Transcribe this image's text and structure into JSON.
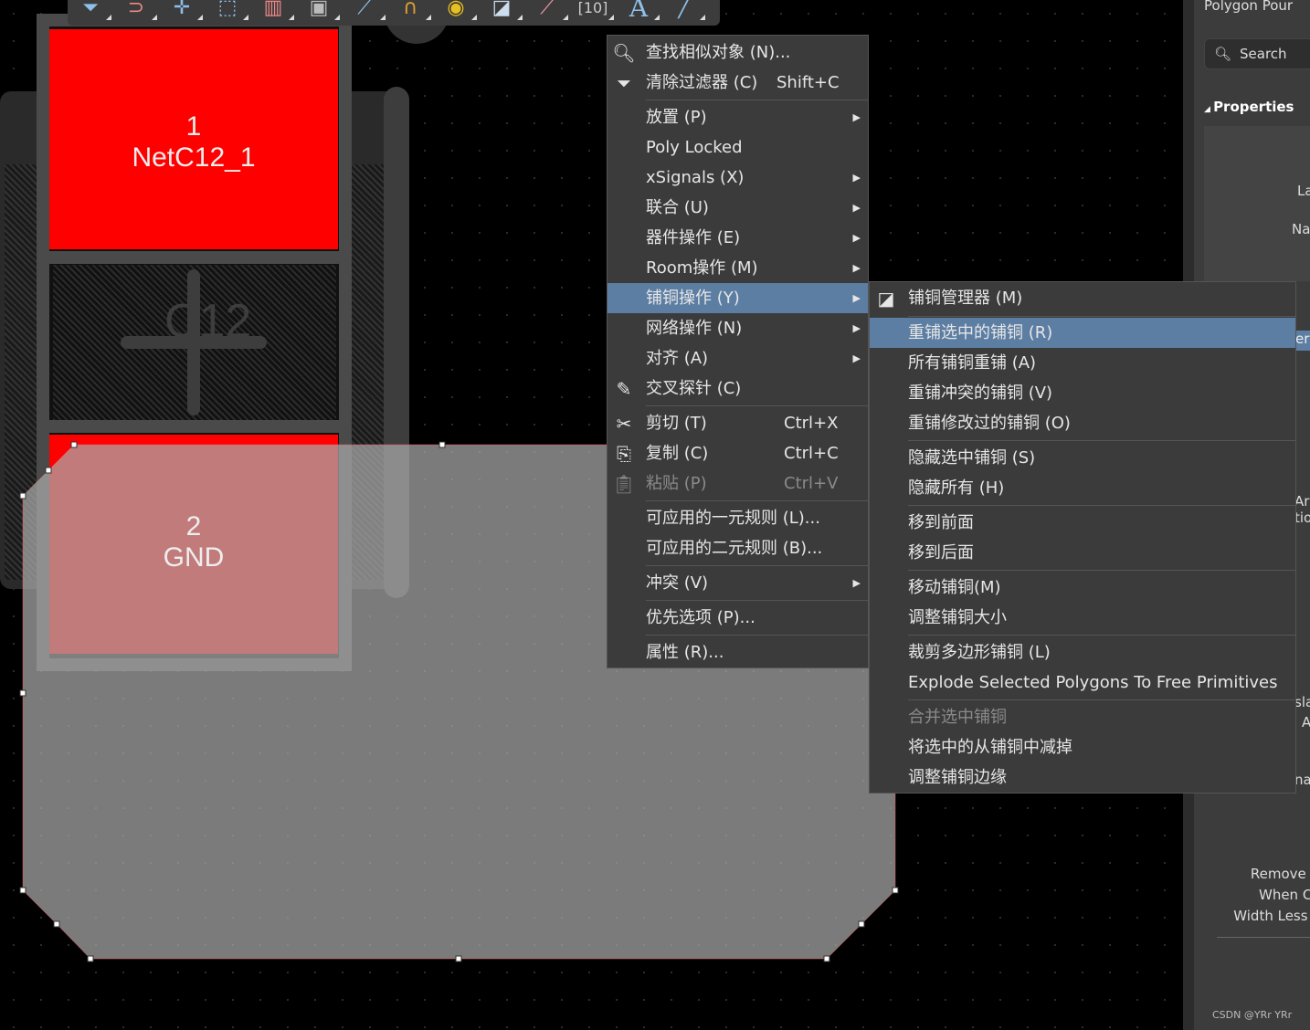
{
  "toolbar": {
    "icons": [
      "filter-icon",
      "magnet-icon",
      "move-icon",
      "select-rect-icon",
      "align-icon",
      "component-icon",
      "route-icon",
      "diff-pair-icon",
      "via-icon",
      "polygon-icon",
      "region-icon",
      "dimension-icon",
      "text-icon",
      "line-icon"
    ]
  },
  "pads": [
    {
      "number": "1",
      "net": "NetC12_1"
    },
    {
      "number": "2",
      "net": "GND"
    }
  ],
  "designator": "C12",
  "context_menu": {
    "items": [
      {
        "label": "查找相似对象 (N)...",
        "icon": "search-icon"
      },
      {
        "label": "清除过滤器 (C)",
        "shortcut": "Shift+C",
        "icon": "clear-filter-icon"
      },
      {
        "label": "放置 (P)",
        "submenu": true
      },
      {
        "label": "Poly Locked"
      },
      {
        "label": "xSignals (X)",
        "submenu": true
      },
      {
        "label": "联合 (U)",
        "submenu": true
      },
      {
        "label": "器件操作 (E)",
        "submenu": true
      },
      {
        "label": "Room操作 (M)",
        "submenu": true
      },
      {
        "label": "铺铜操作 (Y)",
        "submenu": true,
        "highlighted": true
      },
      {
        "label": "网络操作 (N)",
        "submenu": true
      },
      {
        "label": "对齐 (A)",
        "submenu": true
      },
      {
        "label": "交叉探针 (C)",
        "icon": "cross-probe-icon"
      },
      {
        "label": "剪切 (T)",
        "shortcut": "Ctrl+X",
        "icon": "cut-icon"
      },
      {
        "label": "复制 (C)",
        "shortcut": "Ctrl+C",
        "icon": "copy-icon"
      },
      {
        "label": "粘贴 (P)",
        "shortcut": "Ctrl+V",
        "icon": "paste-icon",
        "disabled": true
      },
      {
        "label": "可应用的一元规则 (L)..."
      },
      {
        "label": "可应用的二元规则 (B)..."
      },
      {
        "label": "冲突 (V)",
        "submenu": true
      },
      {
        "label": "优先选项 (P)..."
      },
      {
        "label": "属性 (R)..."
      }
    ]
  },
  "submenu": {
    "items": [
      {
        "label": "铺铜管理器 (M)",
        "icon": "polygon-manager-icon"
      },
      {
        "label": "重铺选中的铺铜 (R)",
        "highlighted": true
      },
      {
        "label": "所有铺铜重铺 (A)"
      },
      {
        "label": "重铺冲突的铺铜 (V)"
      },
      {
        "label": "重铺修改过的铺铜 (O)"
      },
      {
        "label": "隐藏选中铺铜 (S)"
      },
      {
        "label": "隐藏所有 (H)"
      },
      {
        "label": "移到前面"
      },
      {
        "label": "移到后面"
      },
      {
        "label": "移动铺铜(M)"
      },
      {
        "label": "调整铺铜大小"
      },
      {
        "label": "裁剪多边形铺铜 (L)"
      },
      {
        "label": "Explode Selected Polygons To Free Primitives"
      },
      {
        "label": "合并选中铺铜",
        "disabled": true
      },
      {
        "label": "将选中的从铺铜中减掉"
      },
      {
        "label": "调整铺铜边缘"
      }
    ]
  },
  "panel": {
    "title": "Polygon Pour",
    "search_placeholder": "Search",
    "section": "Properties",
    "fragments": [
      "La",
      "Na",
      "er",
      "Ar",
      "tio",
      "sla",
      "A",
      "nat"
    ],
    "remove_text": [
      "Remove Ne",
      "When Cop",
      "Width Less Th"
    ],
    "watermark": "CSDN @YRr YRr"
  },
  "colors": {
    "pad": "#ff0000",
    "menu_bg": "#3b3b3b",
    "highlight": "#5c7ea3",
    "polygon": "#8a8a8a"
  }
}
